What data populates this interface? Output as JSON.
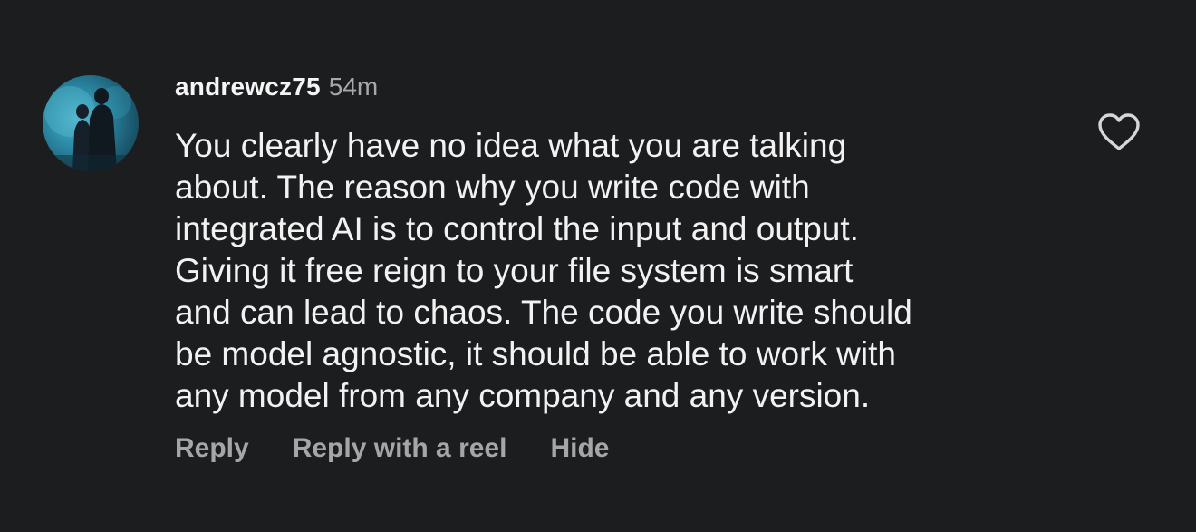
{
  "comment": {
    "username": "andrewcz75",
    "timestamp": "54m",
    "lines": [
      "You clearly have no idea what you are talking",
      "about. The reason why you write code with",
      "integrated AI is to control the input and output.",
      "Giving it free reign to your file system is smart",
      "and can lead to chaos. The code you write should",
      "be model agnostic, it should be able to work with",
      "any model from any company and any version."
    ],
    "actions": {
      "reply": "Reply",
      "reply_with_reel": "Reply with a reel",
      "hide": "Hide"
    },
    "icons": {
      "like": "heart-outline-icon",
      "avatar": "profile-photo"
    }
  },
  "colors": {
    "background": "#1c1d1f",
    "text": "#f2f2f2",
    "muted": "#a8a8a8"
  }
}
